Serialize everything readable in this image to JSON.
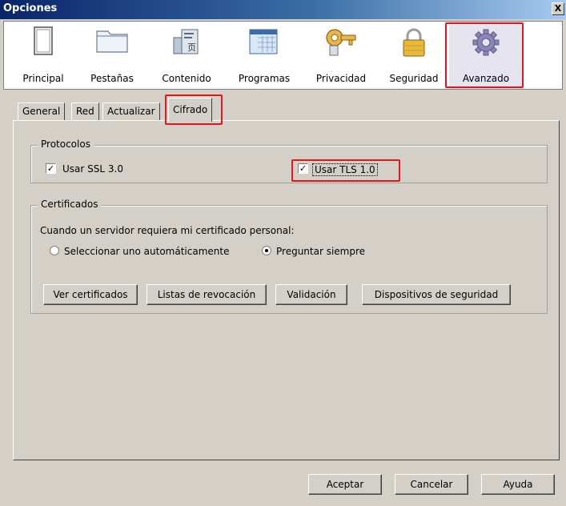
{
  "window": {
    "title": "Opciones",
    "close_label": "X"
  },
  "toolbar": {
    "panes": [
      {
        "label": "Principal",
        "icon": "window-icon"
      },
      {
        "label": "Pestañas",
        "icon": "folder-tabs-icon"
      },
      {
        "label": "Contenido",
        "icon": "document-icon"
      },
      {
        "label": "Programas",
        "icon": "calendar-window-icon"
      },
      {
        "label": "Privacidad",
        "icon": "key-icon"
      },
      {
        "label": "Seguridad",
        "icon": "padlock-icon"
      },
      {
        "label": "Avanzado",
        "icon": "gear-icon"
      }
    ],
    "selected": "Avanzado"
  },
  "tabs": [
    "General",
    "Red",
    "Actualizar",
    "Cifrado"
  ],
  "active_tab": "Cifrado",
  "protocolos": {
    "legend": "Protocolos",
    "ssl_label": "Usar SSL 3.0",
    "ssl_checked": true,
    "tls_label": "Usar TLS 1.0",
    "tls_checked": true
  },
  "certificados": {
    "legend": "Certificados",
    "prompt": "Cuando un servidor requiera mi certificado personal:",
    "radio_auto": "Seleccionar uno automáticamente",
    "radio_auto_selected": false,
    "radio_ask": "Preguntar siempre",
    "radio_ask_selected": true,
    "buttons": [
      "Ver certificados",
      "Listas de revocación",
      "Validación",
      "Dispositivos de seguridad"
    ]
  },
  "dialog_buttons": {
    "accept": "Aceptar",
    "cancel": "Cancelar",
    "help": "Ayuda"
  },
  "colors": {
    "highlight": "#e8141c",
    "titlebar": "#0a246a"
  }
}
